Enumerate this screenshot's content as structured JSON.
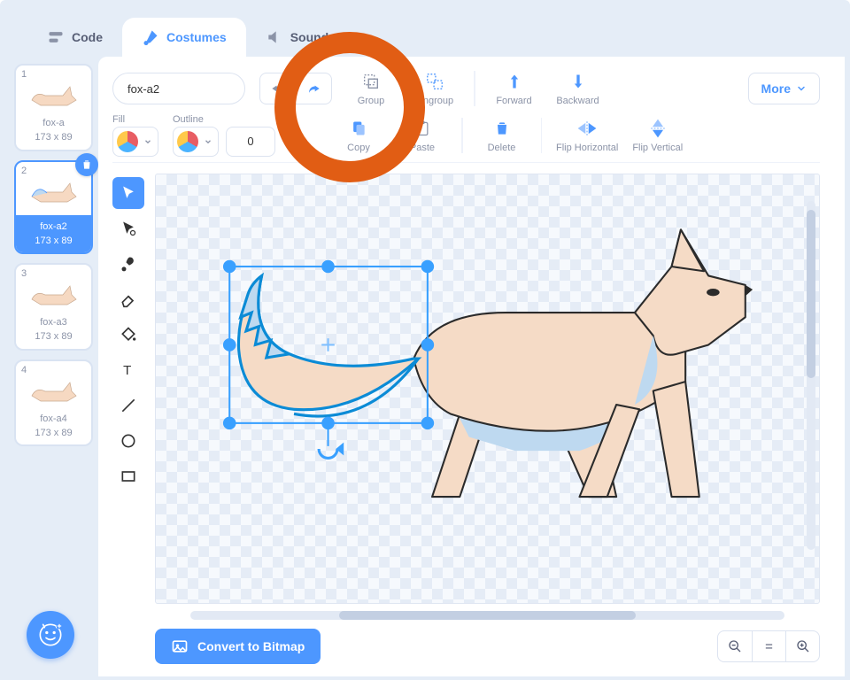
{
  "tabs": {
    "code": "Code",
    "costumes": "Costumes",
    "sounds": "Sounds"
  },
  "costume_name": "fox-a2",
  "fill_label": "Fill",
  "outline_label": "Outline",
  "outline_width": "0",
  "toolbar": {
    "undo": "Undo",
    "redo": "Redo",
    "group": "Group",
    "ungroup": "Ungroup",
    "forward": "Forward",
    "backward": "Backward",
    "more": "More",
    "copy": "Copy",
    "paste": "Paste",
    "delete": "Delete",
    "flip_h": "Flip Horizontal",
    "flip_v": "Flip Vertical"
  },
  "convert": "Convert to Bitmap",
  "costumes": [
    {
      "num": "1",
      "name": "fox-a",
      "dims": "173 x 89",
      "selected": false
    },
    {
      "num": "2",
      "name": "fox-a2",
      "dims": "173 x 89",
      "selected": true
    },
    {
      "num": "3",
      "name": "fox-a3",
      "dims": "173 x 89",
      "selected": false
    },
    {
      "num": "4",
      "name": "fox-a4",
      "dims": "173 x 89",
      "selected": false
    }
  ],
  "zoom": {
    "out": "−",
    "reset": "=",
    "in": "+"
  }
}
